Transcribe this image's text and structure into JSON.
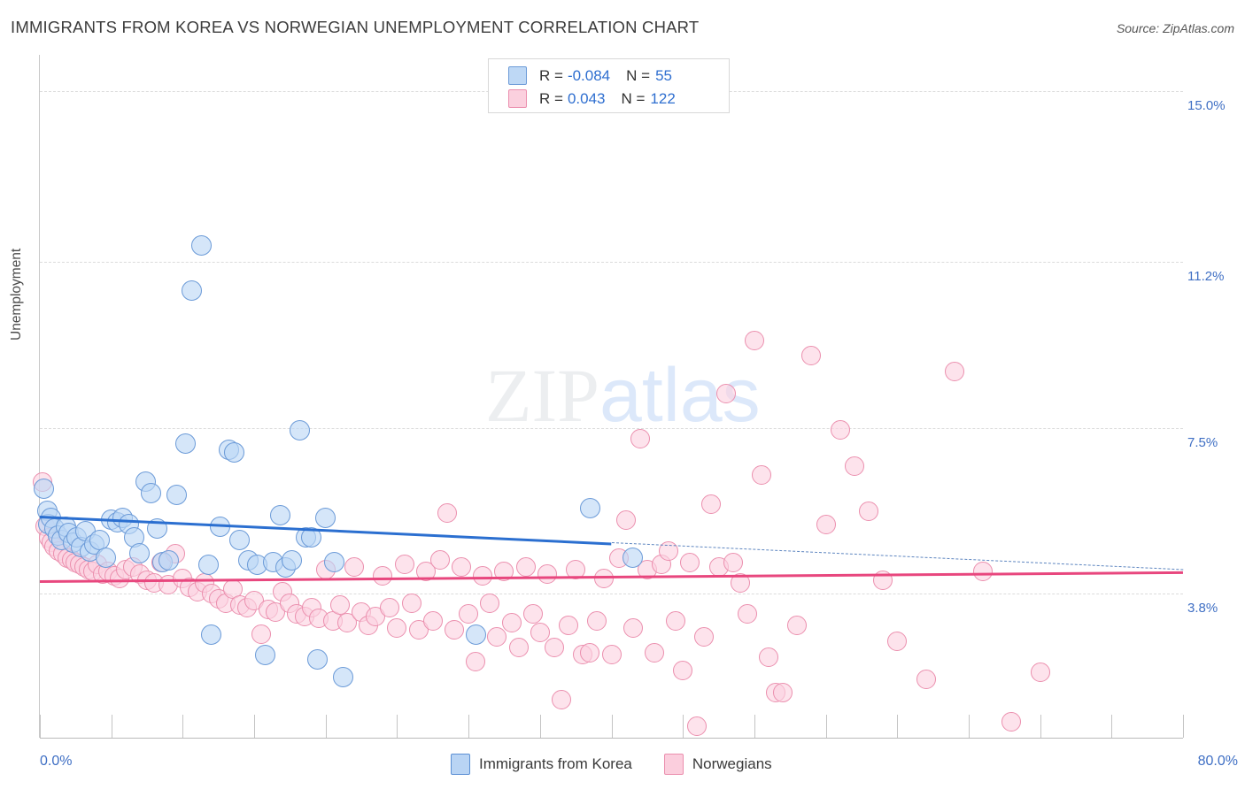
{
  "header": {
    "title": "IMMIGRANTS FROM KOREA VS NORWEGIAN UNEMPLOYMENT CORRELATION CHART",
    "source": "Source: ZipAtlas.com"
  },
  "watermark": {
    "part1": "ZIP",
    "part2": "atlas"
  },
  "stats_legend": {
    "rows": [
      {
        "series": "Immigrants from Korea",
        "r_label": "R =",
        "r_value": "-0.084",
        "n_label": "N =",
        "n_value": "55",
        "color": "#bed8f5"
      },
      {
        "series": "Norwegians",
        "r_label": "R =",
        "r_value": "0.043",
        "n_label": "N =",
        "n_value": "122",
        "color": "#fbd0de"
      }
    ]
  },
  "series_legend": [
    {
      "label": "Immigrants from Korea",
      "color": "#b9d4f4"
    },
    {
      "label": "Norwegians",
      "color": "#fbcedd"
    }
  ],
  "chart_data": {
    "type": "scatter",
    "title": "IMMIGRANTS FROM KOREA VS NORWEGIAN UNEMPLOYMENT CORRELATION CHART",
    "xlabel": "Immigrants from Korea",
    "ylabel": "Unemployment",
    "xlim": [
      0.0,
      80.0
    ],
    "ylim": [
      0.6,
      15.8
    ],
    "x_tick_labels": [
      "0.0%",
      "80.0%"
    ],
    "y_tick_labels": [
      "15.0%",
      "11.2%",
      "7.5%",
      "3.8%"
    ],
    "y_gridlines": [
      15.0,
      11.2,
      7.5,
      3.8
    ],
    "grid": true,
    "legend_position": "top-center",
    "colors": {
      "blue": "#bed8f5",
      "blue_edge": "#6c9bd8",
      "pink": "#fbd0de",
      "pink_edge": "#eb8fae",
      "blue_line": "#2b6fd0",
      "pink_line": "#e8477e",
      "axis_text": "#3f6fc4"
    },
    "series": [
      {
        "name": "Immigrants from Korea",
        "r": -0.084,
        "n": 55,
        "trend": {
          "x0": 0.0,
          "y0": 5.55,
          "x1": 40.0,
          "y1": 4.95,
          "solid_to_x": 40.0,
          "dashed_to_x": 80.0,
          "y_at_80": 4.35
        },
        "points": [
          [
            0.3,
            6.15
          ],
          [
            0.5,
            5.65
          ],
          [
            0.6,
            5.35
          ],
          [
            0.8,
            5.5
          ],
          [
            1.0,
            5.25
          ],
          [
            1.3,
            5.1
          ],
          [
            1.5,
            5.0
          ],
          [
            1.8,
            5.3
          ],
          [
            2.0,
            5.15
          ],
          [
            2.3,
            4.95
          ],
          [
            2.6,
            5.05
          ],
          [
            2.9,
            4.85
          ],
          [
            3.2,
            5.2
          ],
          [
            3.5,
            4.75
          ],
          [
            3.8,
            4.9
          ],
          [
            4.2,
            5.0
          ],
          [
            4.6,
            4.6
          ],
          [
            5.0,
            5.45
          ],
          [
            5.4,
            5.4
          ],
          [
            5.8,
            5.5
          ],
          [
            6.2,
            5.35
          ],
          [
            6.6,
            5.05
          ],
          [
            7.0,
            4.7
          ],
          [
            7.4,
            6.3
          ],
          [
            7.8,
            6.05
          ],
          [
            8.2,
            5.25
          ],
          [
            8.6,
            4.5
          ],
          [
            9.0,
            4.55
          ],
          [
            9.6,
            6.0
          ],
          [
            10.2,
            7.15
          ],
          [
            10.6,
            10.55
          ],
          [
            11.3,
            11.55
          ],
          [
            11.8,
            4.45
          ],
          [
            12.0,
            2.9
          ],
          [
            12.6,
            5.3
          ],
          [
            13.2,
            7.0
          ],
          [
            13.6,
            6.95
          ],
          [
            14.0,
            5.0
          ],
          [
            14.6,
            4.55
          ],
          [
            15.2,
            4.45
          ],
          [
            15.8,
            2.45
          ],
          [
            16.3,
            4.5
          ],
          [
            16.8,
            5.55
          ],
          [
            17.2,
            4.4
          ],
          [
            17.6,
            4.55
          ],
          [
            18.2,
            7.45
          ],
          [
            18.6,
            5.05
          ],
          [
            19.0,
            5.05
          ],
          [
            19.4,
            2.35
          ],
          [
            20.0,
            5.5
          ],
          [
            20.6,
            4.5
          ],
          [
            21.2,
            1.95
          ],
          [
            30.5,
            2.9
          ],
          [
            38.5,
            5.7
          ],
          [
            41.5,
            4.6
          ]
        ]
      },
      {
        "name": "Norwegians",
        "r": 0.043,
        "n": 122,
        "trend": {
          "x0": 0.0,
          "y0": 4.1,
          "x1": 80.0,
          "y1": 4.3
        },
        "points": [
          [
            0.2,
            6.3
          ],
          [
            0.4,
            5.3
          ],
          [
            0.6,
            5.05
          ],
          [
            0.8,
            4.95
          ],
          [
            1.0,
            4.85
          ],
          [
            1.3,
            4.75
          ],
          [
            1.6,
            4.7
          ],
          [
            1.9,
            4.6
          ],
          [
            2.2,
            4.55
          ],
          [
            2.5,
            4.5
          ],
          [
            2.8,
            4.45
          ],
          [
            3.1,
            4.4
          ],
          [
            3.4,
            4.35
          ],
          [
            3.7,
            4.3
          ],
          [
            4.0,
            4.45
          ],
          [
            4.4,
            4.25
          ],
          [
            4.8,
            4.3
          ],
          [
            5.2,
            4.2
          ],
          [
            5.6,
            4.15
          ],
          [
            6.0,
            4.35
          ],
          [
            6.5,
            4.4
          ],
          [
            7.0,
            4.25
          ],
          [
            7.5,
            4.1
          ],
          [
            8.0,
            4.05
          ],
          [
            8.5,
            4.5
          ],
          [
            9.0,
            4.0
          ],
          [
            9.5,
            4.7
          ],
          [
            10.0,
            4.15
          ],
          [
            10.5,
            3.95
          ],
          [
            11.0,
            3.85
          ],
          [
            11.5,
            4.05
          ],
          [
            12.0,
            3.8
          ],
          [
            12.5,
            3.7
          ],
          [
            13.0,
            3.6
          ],
          [
            13.5,
            3.9
          ],
          [
            14.0,
            3.55
          ],
          [
            14.5,
            3.5
          ],
          [
            15.0,
            3.65
          ],
          [
            15.5,
            2.9
          ],
          [
            16.0,
            3.45
          ],
          [
            16.5,
            3.4
          ],
          [
            17.0,
            3.85
          ],
          [
            17.5,
            3.6
          ],
          [
            18.0,
            3.35
          ],
          [
            18.5,
            3.3
          ],
          [
            19.0,
            3.5
          ],
          [
            19.5,
            3.25
          ],
          [
            20.0,
            4.35
          ],
          [
            20.5,
            3.2
          ],
          [
            21.0,
            3.55
          ],
          [
            21.5,
            3.15
          ],
          [
            22.0,
            4.4
          ],
          [
            22.5,
            3.4
          ],
          [
            23.0,
            3.1
          ],
          [
            23.5,
            3.3
          ],
          [
            24.0,
            4.2
          ],
          [
            24.5,
            3.5
          ],
          [
            25.0,
            3.05
          ],
          [
            25.5,
            4.45
          ],
          [
            26.0,
            3.6
          ],
          [
            26.5,
            3.0
          ],
          [
            27.0,
            4.3
          ],
          [
            27.5,
            3.2
          ],
          [
            28.0,
            4.55
          ],
          [
            28.5,
            5.6
          ],
          [
            29.0,
            3.0
          ],
          [
            29.5,
            4.4
          ],
          [
            30.0,
            3.35
          ],
          [
            30.5,
            2.3
          ],
          [
            31.0,
            4.2
          ],
          [
            31.5,
            3.6
          ],
          [
            32.0,
            2.85
          ],
          [
            32.5,
            4.3
          ],
          [
            33.0,
            3.15
          ],
          [
            33.5,
            2.6
          ],
          [
            34.0,
            4.4
          ],
          [
            34.5,
            3.35
          ],
          [
            35.0,
            2.95
          ],
          [
            35.5,
            4.25
          ],
          [
            36.0,
            2.6
          ],
          [
            36.5,
            1.45
          ],
          [
            37.0,
            3.1
          ],
          [
            37.5,
            4.35
          ],
          [
            38.0,
            2.45
          ],
          [
            38.5,
            2.5
          ],
          [
            39.0,
            3.2
          ],
          [
            39.5,
            4.15
          ],
          [
            40.0,
            2.45
          ],
          [
            40.5,
            4.6
          ],
          [
            41.0,
            5.45
          ],
          [
            41.5,
            3.05
          ],
          [
            42.0,
            7.25
          ],
          [
            42.5,
            4.35
          ],
          [
            43.0,
            2.5
          ],
          [
            43.5,
            4.45
          ],
          [
            44.0,
            4.75
          ],
          [
            44.5,
            3.2
          ],
          [
            45.0,
            2.1
          ],
          [
            45.5,
            4.5
          ],
          [
            46.0,
            0.85
          ],
          [
            46.5,
            2.85
          ],
          [
            47.0,
            5.8
          ],
          [
            47.5,
            4.4
          ],
          [
            48.0,
            8.25
          ],
          [
            48.5,
            4.5
          ],
          [
            49.0,
            4.05
          ],
          [
            49.5,
            3.35
          ],
          [
            50.0,
            9.45
          ],
          [
            50.5,
            6.45
          ],
          [
            51.0,
            2.4
          ],
          [
            51.5,
            1.6
          ],
          [
            52.0,
            1.6
          ],
          [
            53.0,
            3.1
          ],
          [
            54.0,
            9.1
          ],
          [
            55.0,
            5.35
          ],
          [
            56.0,
            7.45
          ],
          [
            57.0,
            6.65
          ],
          [
            58.0,
            5.65
          ],
          [
            59.0,
            4.1
          ],
          [
            60.0,
            2.75
          ],
          [
            62.0,
            1.9
          ],
          [
            64.0,
            8.75
          ],
          [
            66.0,
            4.3
          ],
          [
            68.0,
            0.95
          ],
          [
            70.0,
            2.05
          ]
        ]
      }
    ]
  }
}
